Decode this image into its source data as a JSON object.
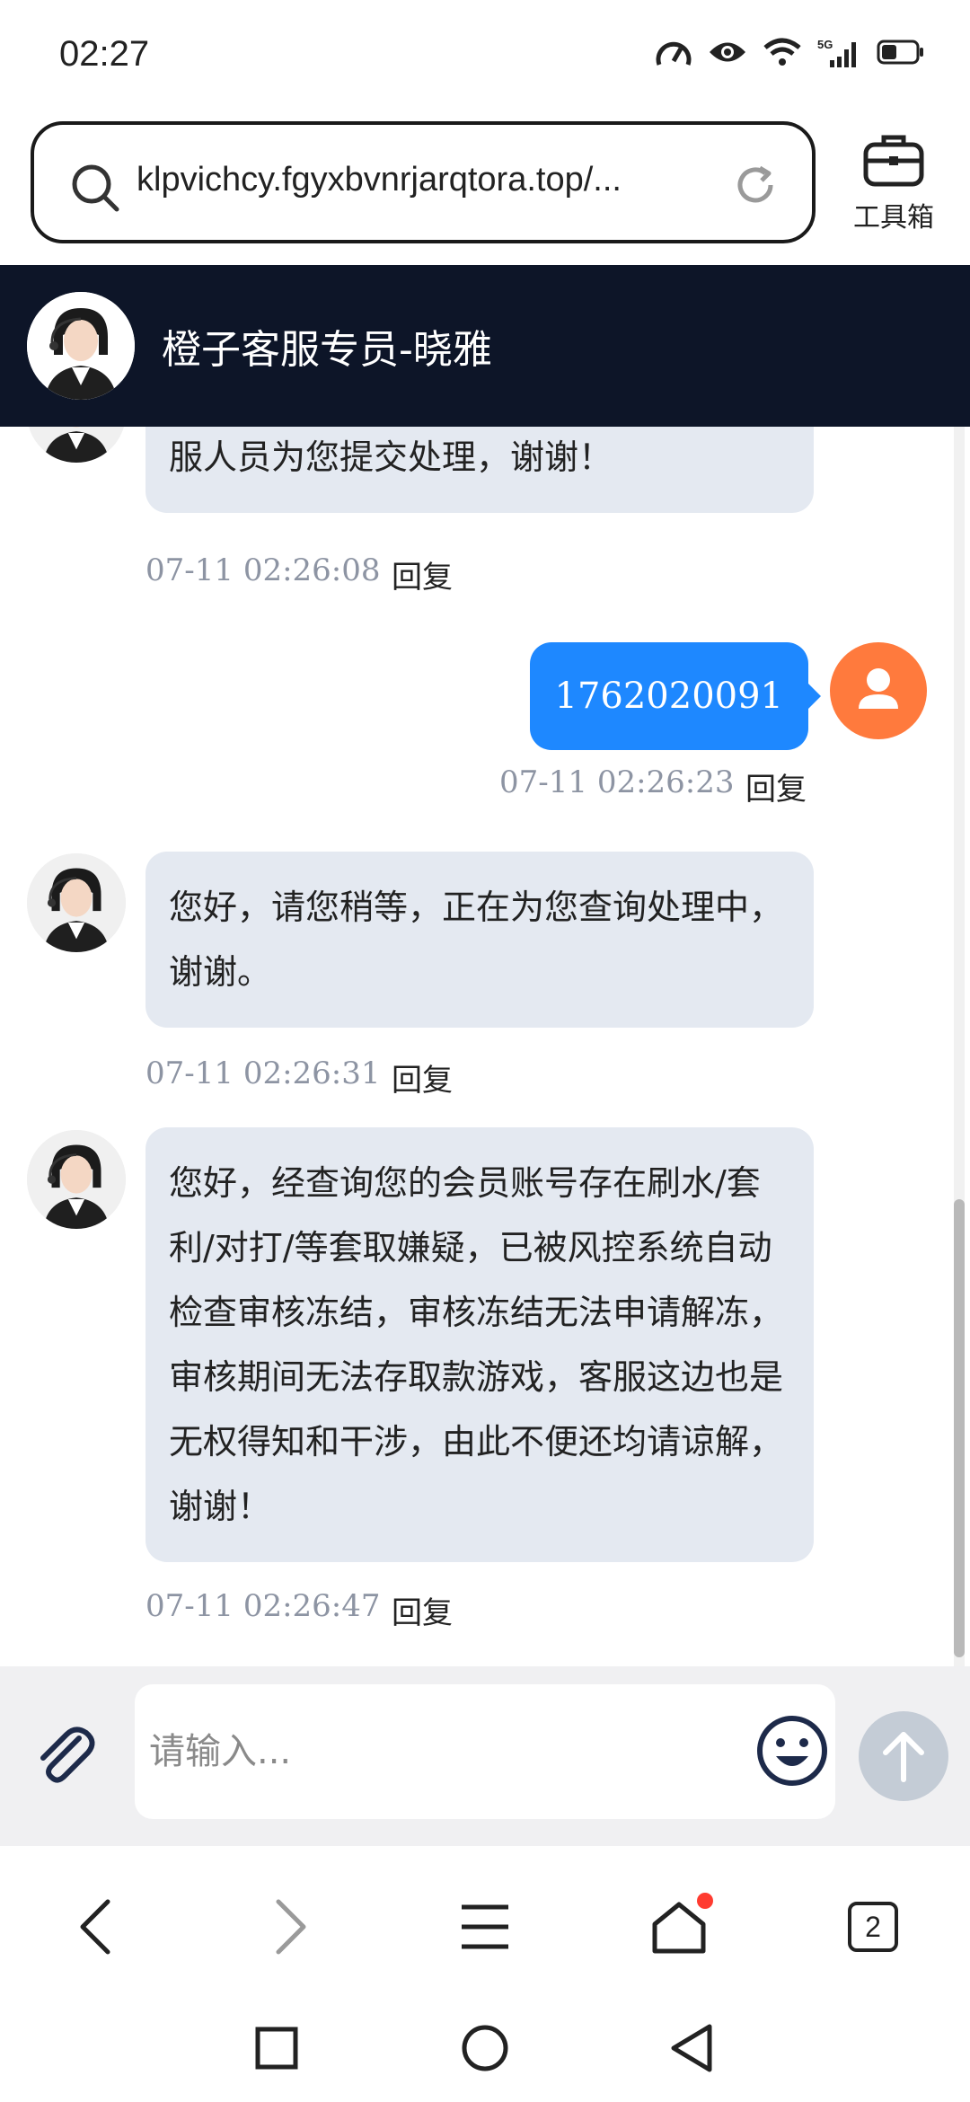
{
  "status_bar": {
    "time": "02:27",
    "icons": [
      "speed-icon",
      "eye-icon",
      "wifi-icon",
      "5g-signal-icon",
      "battery-icon"
    ],
    "network_label": "5G"
  },
  "browser": {
    "url": "klpvichcy.fgyxbvnrjarqtora.top/...",
    "toolbox_label": "工具箱",
    "tabs_count": "2"
  },
  "chat": {
    "title": "橙子客服专员-晓雅",
    "reply_label": "回复",
    "messages": [
      {
        "from": "agent",
        "text": "您好，麻烦您提供下您的用户ID，方便客服人员为您提交处理，谢谢！",
        "time": "07-11 02:26:08"
      },
      {
        "from": "user",
        "text": "1762020091",
        "time": "07-11 02:26:23"
      },
      {
        "from": "agent",
        "text": "您好，请您稍等，正在为您查询处理中，谢谢。",
        "time": "07-11 02:26:31"
      },
      {
        "from": "agent",
        "text": "您好，经查询您的会员账号存在刷水/套利/对打/等套取嫌疑，已被风控系统自动检查审核冻结，审核冻结无法申请解冻，审核期间无法存取款游戏，客服这边也是无权得知和干涉，由此不便还均请谅解，谢谢！",
        "time": "07-11 02:26:47"
      }
    ]
  },
  "input": {
    "placeholder": "请输入..."
  },
  "colors": {
    "header_bg": "#0d1528",
    "agent_bubble": "#e4e9f1",
    "user_bubble": "#1e88ff",
    "user_avatar": "#ff7a3d",
    "send_disabled": "#c4ccd6"
  }
}
